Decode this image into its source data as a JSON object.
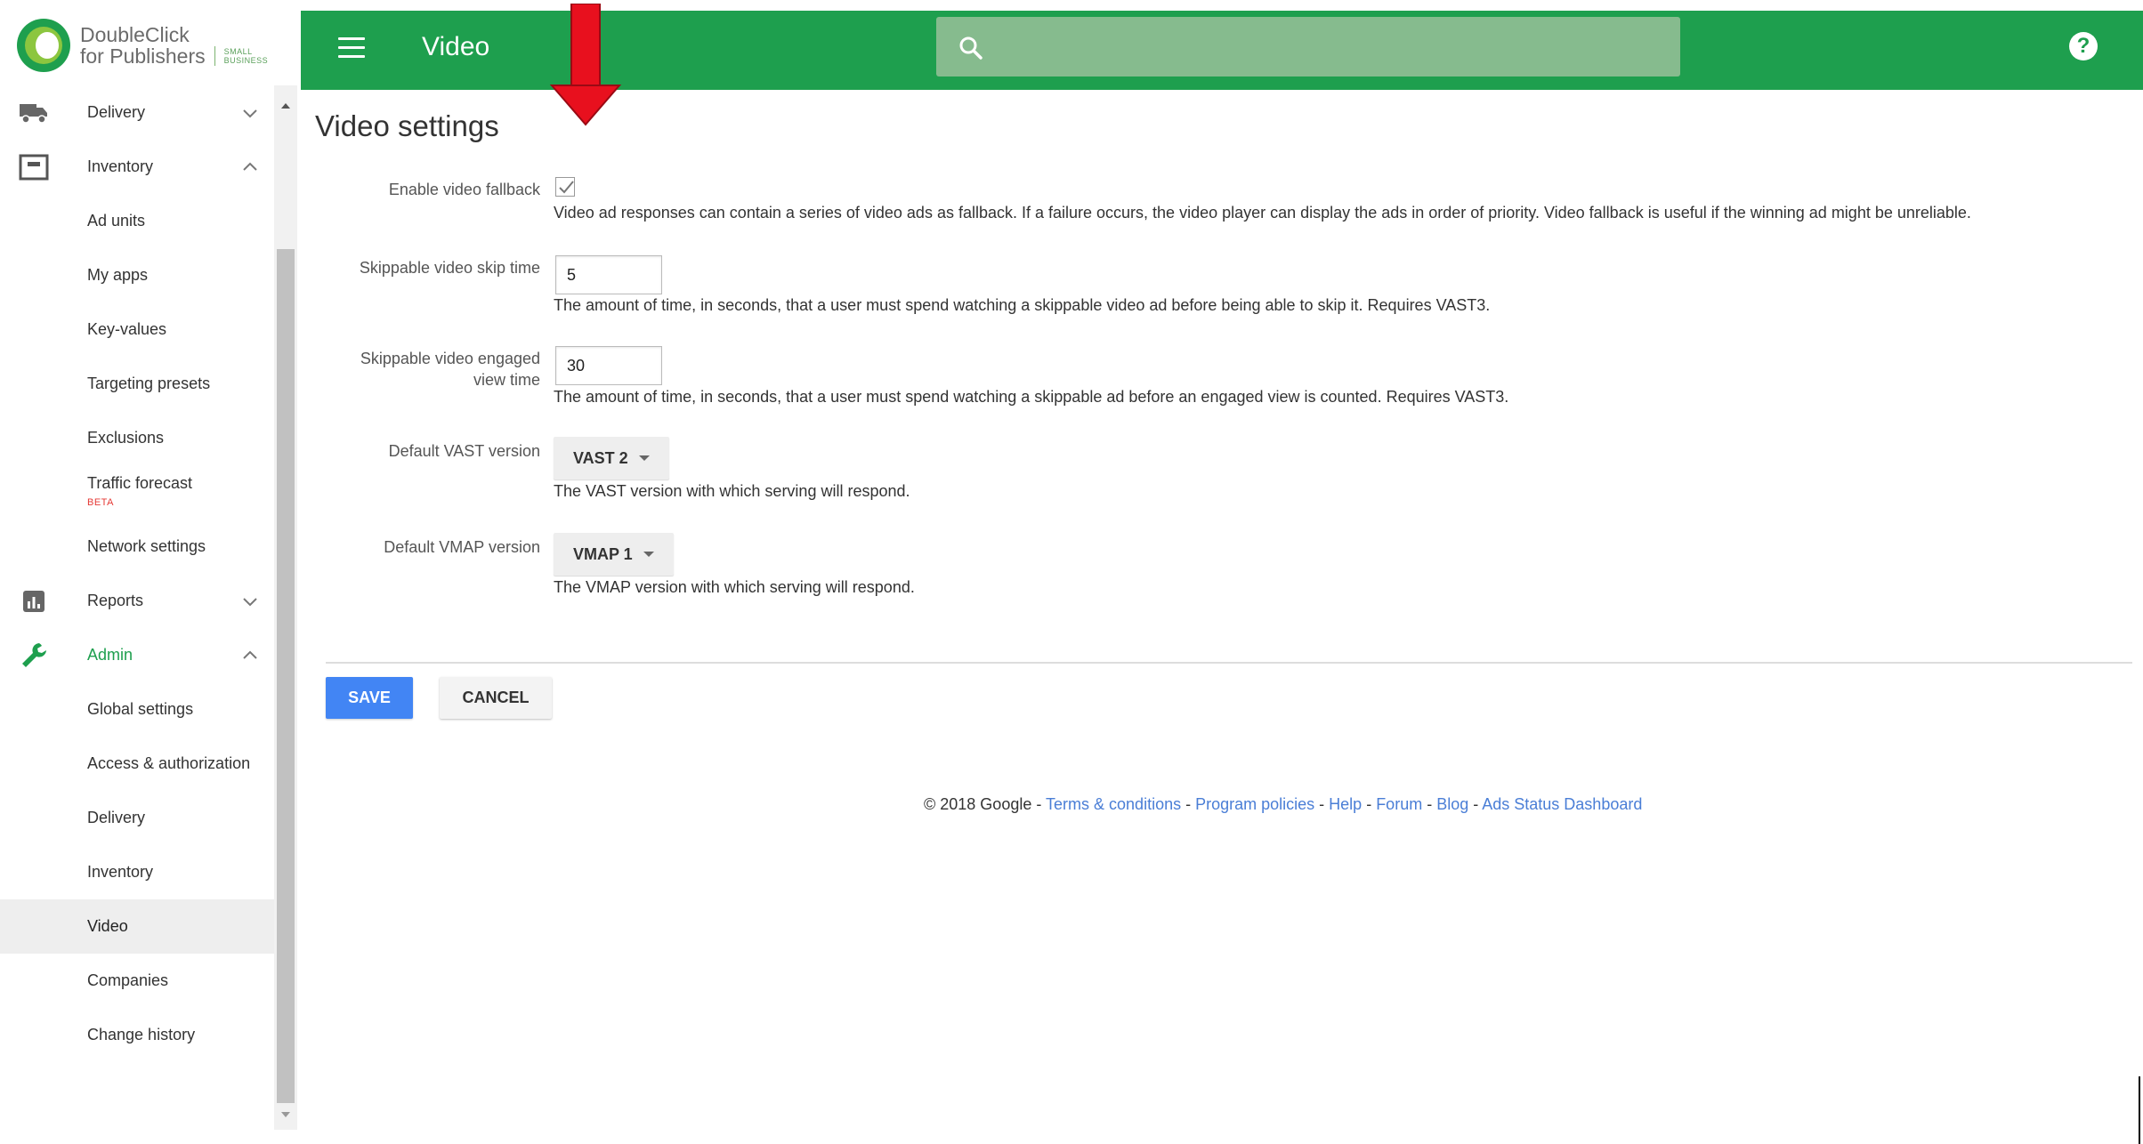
{
  "brand": {
    "line1": "DoubleClick",
    "line2": "for Publishers",
    "small_business": "SMALL BUSINESS",
    "accent_color": "#1e9f4e"
  },
  "header": {
    "title": "Video",
    "search_placeholder": "",
    "help_label": "?"
  },
  "sidebar": {
    "items": [
      {
        "label": "Delivery",
        "icon": "truck-icon",
        "expandable": true,
        "expanded": false
      },
      {
        "label": "Inventory",
        "icon": "inventory-icon",
        "expandable": true,
        "expanded": true
      },
      {
        "label": "Ad units"
      },
      {
        "label": "My apps"
      },
      {
        "label": "Key-values"
      },
      {
        "label": "Targeting presets"
      },
      {
        "label": "Exclusions"
      },
      {
        "label": "Traffic forecast",
        "badge": "BETA"
      },
      {
        "label": "Network settings"
      },
      {
        "label": "Reports",
        "icon": "reports-icon",
        "expandable": true,
        "expanded": false
      },
      {
        "label": "Admin",
        "icon": "wrench-icon",
        "expandable": true,
        "expanded": true,
        "active": true
      },
      {
        "label": "Global settings"
      },
      {
        "label": "Access & authorization"
      },
      {
        "label": "Delivery"
      },
      {
        "label": "Inventory"
      },
      {
        "label": "Video",
        "selected": true
      },
      {
        "label": "Companies"
      },
      {
        "label": "Change history"
      }
    ]
  },
  "page": {
    "title": "Video settings",
    "fields": {
      "fallback": {
        "label": "Enable video fallback",
        "checked": true,
        "description": "Video ad responses can contain a series of video ads as fallback. If a failure occurs, the video player can display the ads in order of priority. Video fallback is useful if the winning ad might be unreliable."
      },
      "skip_time": {
        "label": "Skippable video skip time",
        "value": "5",
        "description": "The amount of time, in seconds, that a user must spend watching a skippable video ad before being able to skip it. Requires VAST3."
      },
      "engaged_time": {
        "label_line1": "Skippable video engaged",
        "label_line2": "view time",
        "value": "30",
        "description": "The amount of time, in seconds, that a user must spend watching a skippable ad before an engaged view is counted. Requires VAST3."
      },
      "vast": {
        "label": "Default VAST version",
        "value": "VAST 2",
        "description": "The VAST version with which serving will respond."
      },
      "vmap": {
        "label": "Default VMAP version",
        "value": "VMAP 1",
        "description": "The VMAP version with which serving will respond."
      }
    },
    "buttons": {
      "save": "SAVE",
      "cancel": "CANCEL"
    },
    "footer": {
      "copyright": "© 2018 Google",
      "links": [
        "Terms & conditions",
        "Program policies",
        "Help",
        "Forum",
        "Blog",
        "Ads Status Dashboard"
      ],
      "separator": " - "
    }
  }
}
